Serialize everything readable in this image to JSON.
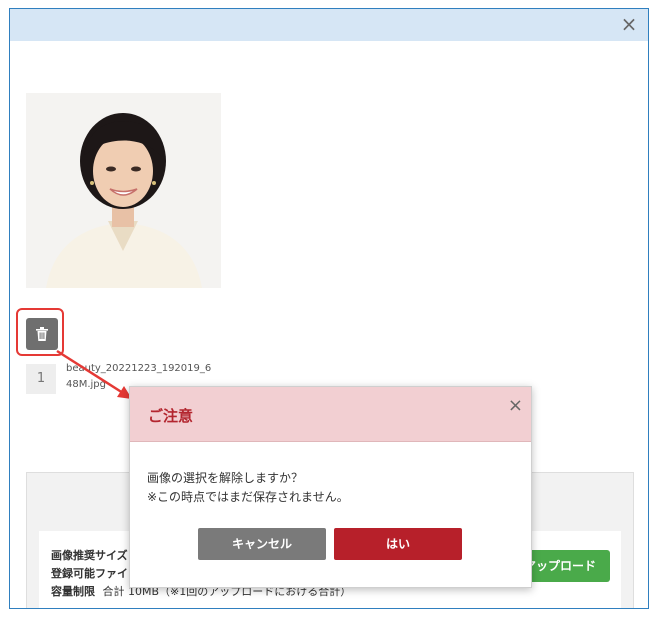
{
  "modal": {
    "close_icon": "close-icon",
    "photo_alt": "uploaded-photo",
    "file_index": "1",
    "file_name": "beauty_20221223_192019_648M.jpg"
  },
  "bottom": {
    "line1_label": "画像推奨サイズ",
    "line2_label": "登録可能ファイ",
    "line3_label": "容量制限",
    "line3_value": "合計 10MB（※1回のアップロードにおける合計）",
    "upload_label": "アップロード"
  },
  "dialog": {
    "title": "ご注意",
    "message_line1": "画像の選択を解除しますか？",
    "message_line2": "※この時点ではまだ保存されません。",
    "cancel_label": "キャンセル",
    "yes_label": "はい"
  },
  "colors": {
    "header_bg": "#d6e6f5",
    "dialog_header_bg": "#f2cfd2",
    "danger": "#b7202a",
    "upload": "#4aaa4a",
    "highlight": "#e53935"
  }
}
